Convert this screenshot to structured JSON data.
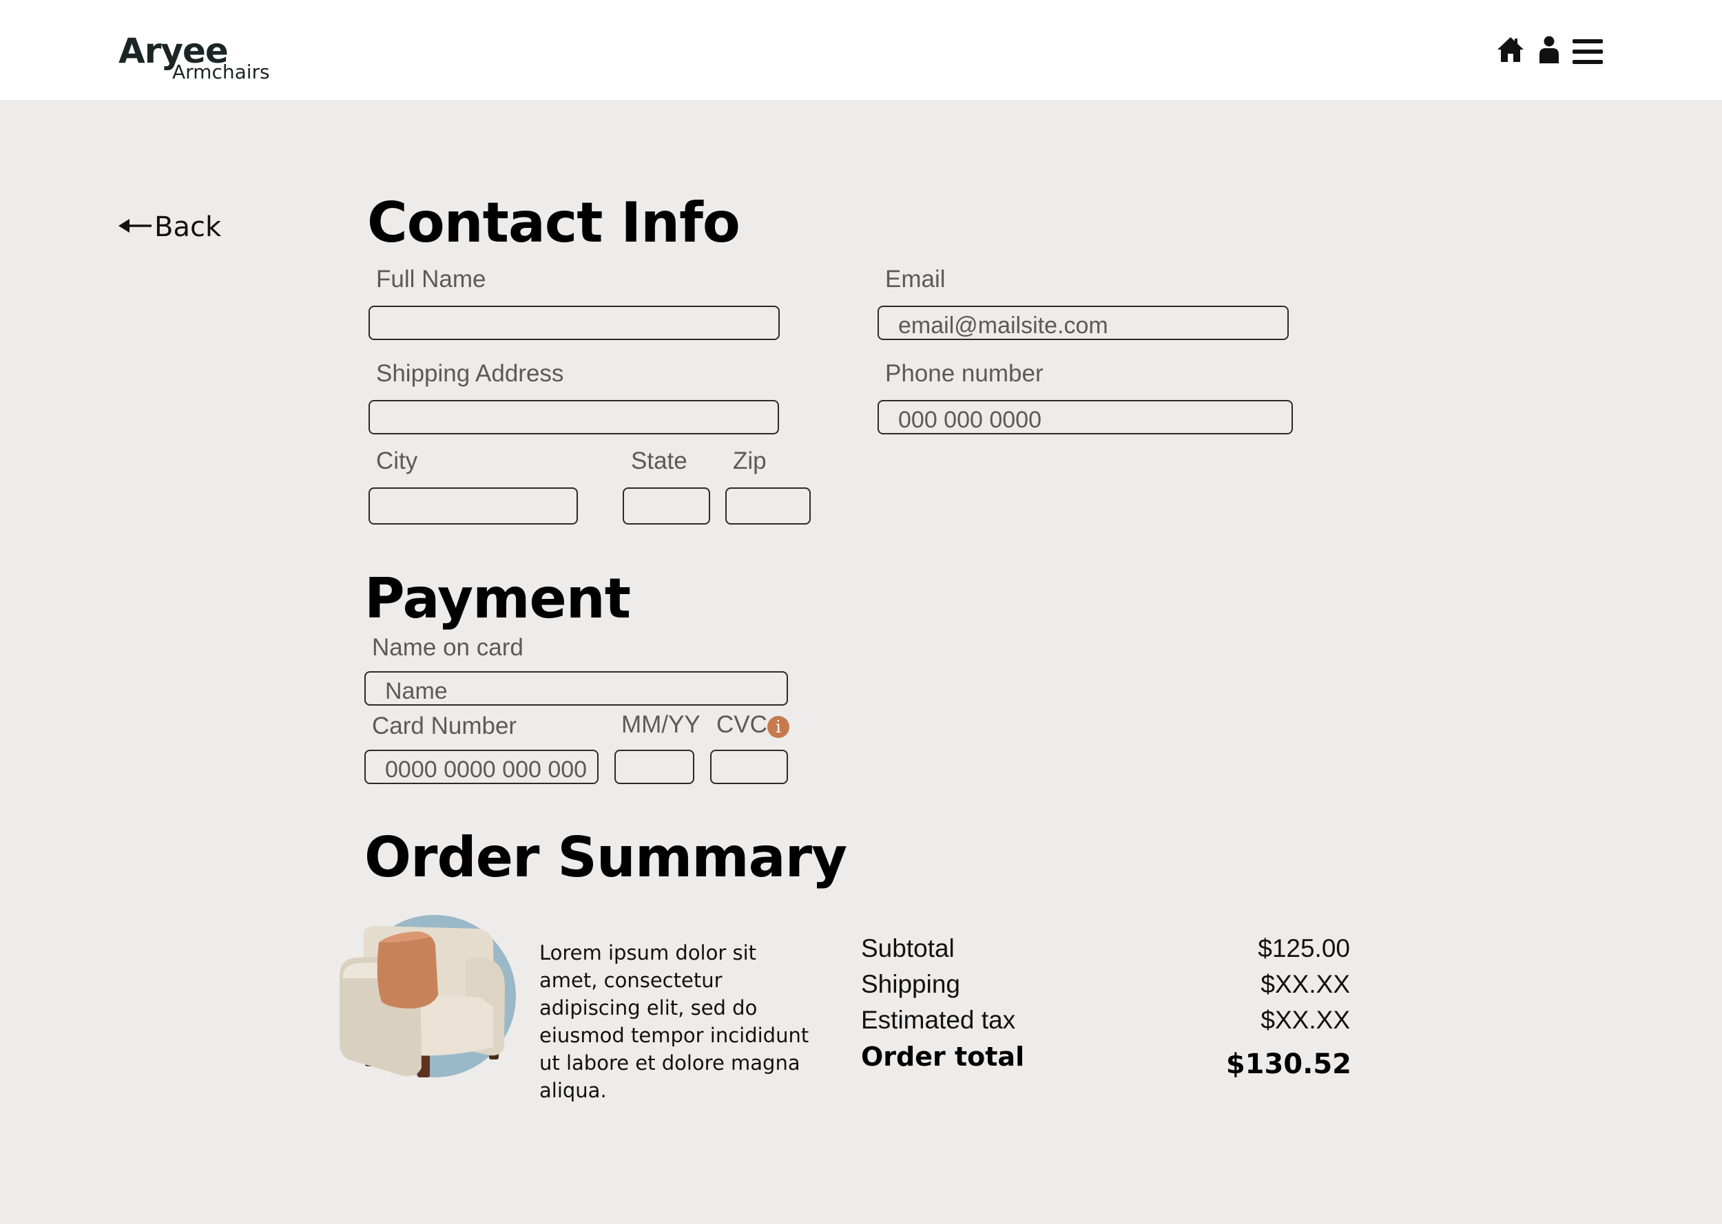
{
  "brand": {
    "name": "Aryee",
    "tagline": "Armchairs"
  },
  "header": {
    "icons": [
      "home-icon",
      "user-icon",
      "menu-icon"
    ]
  },
  "back": {
    "label": "Back",
    "icon": "arrow-left-icon"
  },
  "contact": {
    "title": "Contact Info",
    "full_name": {
      "label": "Full Name",
      "value": ""
    },
    "email": {
      "label": "Email",
      "placeholder": "email@mailsite.com"
    },
    "shipping_address": {
      "label": "Shipping Address",
      "value": ""
    },
    "phone": {
      "label": "Phone number",
      "placeholder": "000 000 0000"
    },
    "city": {
      "label": "City",
      "value": ""
    },
    "state": {
      "label": "State",
      "value": ""
    },
    "zip": {
      "label": "Zip",
      "value": ""
    }
  },
  "payment": {
    "title": "Payment",
    "name_on_card": {
      "label": "Name on card",
      "placeholder": "Name"
    },
    "card_number": {
      "label": "Card Number",
      "placeholder": "0000 0000 000 000"
    },
    "expiry": {
      "label": "MM/YY",
      "value": ""
    },
    "cvc": {
      "label": "CVC",
      "value": "",
      "info_icon": "info-icon",
      "info_glyph": "i"
    }
  },
  "order": {
    "title": "Order Summary",
    "product": {
      "image": "armchair-image",
      "description": "Lorem ipsum dolor sit amet, consectetur adipiscing elit, sed do eiusmod tempor incididunt ut labore et dolore magna aliqua."
    },
    "subtotal": {
      "label": "Subtotal",
      "value": "$125.00"
    },
    "shipping": {
      "label": "Shipping",
      "value": "$XX.XX"
    },
    "tax": {
      "label": "Estimated tax",
      "value": "$XX.XX"
    },
    "total": {
      "label": "Order total",
      "value": "$130.52"
    }
  },
  "colors": {
    "background": "#edecea",
    "header": "#ffffff",
    "brand_text": "#1c2526",
    "accent_info": "#c67a4c",
    "product_circle": "#9ab8c8"
  }
}
